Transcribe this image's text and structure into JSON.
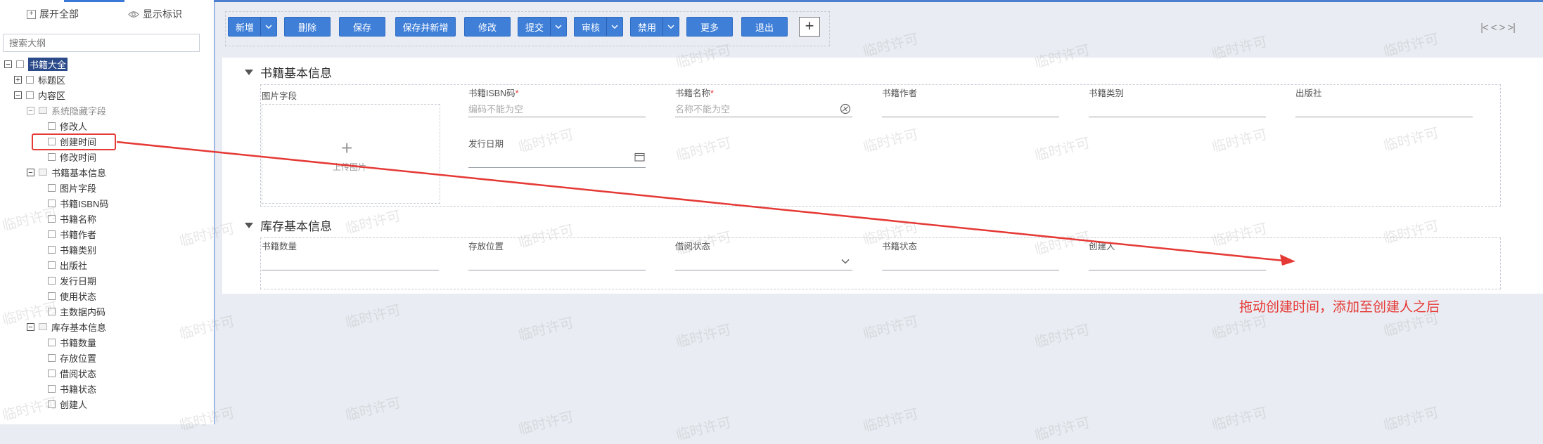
{
  "sidebar": {
    "expand_all": "展开全部",
    "show_marks": "显示标识",
    "search_placeholder": "搜索大纲",
    "tree": [
      {
        "label": "书籍大全",
        "toggle": "−",
        "level": 0,
        "selected": true
      },
      {
        "label": "标题区",
        "toggle": "+",
        "level": 1
      },
      {
        "label": "内容区",
        "toggle": "−",
        "level": 1
      },
      {
        "label": "系统隐藏字段",
        "toggle": "−",
        "level": 2,
        "dim": true
      },
      {
        "label": "修改人",
        "level": 3
      },
      {
        "label": "创建时间",
        "level": 3
      },
      {
        "label": "修改时间",
        "level": 3
      },
      {
        "label": "书籍基本信息",
        "toggle": "−",
        "level": 2
      },
      {
        "label": "图片字段",
        "level": 3
      },
      {
        "label": "书籍ISBN码",
        "level": 3
      },
      {
        "label": "书籍名称",
        "level": 3
      },
      {
        "label": "书籍作者",
        "level": 3
      },
      {
        "label": "书籍类别",
        "level": 3
      },
      {
        "label": "出版社",
        "level": 3
      },
      {
        "label": "发行日期",
        "level": 3
      },
      {
        "label": "使用状态",
        "level": 3
      },
      {
        "label": "主数据内码",
        "level": 3
      },
      {
        "label": "库存基本信息",
        "toggle": "−",
        "level": 2
      },
      {
        "label": "书籍数量",
        "level": 3
      },
      {
        "label": "存放位置",
        "level": 3
      },
      {
        "label": "借阅状态",
        "level": 3
      },
      {
        "label": "书籍状态",
        "level": 3
      },
      {
        "label": "创建人",
        "level": 3
      }
    ]
  },
  "toolbar": {
    "buttons": [
      {
        "label": "新增",
        "dropdown": true
      },
      {
        "label": "删除"
      },
      {
        "label": "保存"
      },
      {
        "label": "保存并新增"
      },
      {
        "label": "修改"
      },
      {
        "label": "提交",
        "dropdown": true
      },
      {
        "label": "审核",
        "dropdown": true
      },
      {
        "label": "禁用",
        "dropdown": true
      },
      {
        "label": "更多"
      },
      {
        "label": "退出"
      }
    ],
    "add_symbol": "+",
    "nav_symbols": [
      "|<",
      "<",
      ">",
      ">|"
    ]
  },
  "sections": {
    "basic": {
      "title": "书籍基本信息",
      "image_label": "图片字段",
      "upload_text": "上传图片",
      "fields": {
        "isbn": {
          "label": "书籍ISBN码",
          "required": "*",
          "placeholder": "编码不能为空"
        },
        "name": {
          "label": "书籍名称",
          "required": "*",
          "placeholder": "名称不能为空"
        },
        "author": {
          "label": "书籍作者"
        },
        "category": {
          "label": "书籍类别"
        },
        "publisher": {
          "label": "出版社"
        },
        "release_date": {
          "label": "发行日期"
        }
      }
    },
    "stock": {
      "title": "库存基本信息",
      "fields": {
        "quantity": {
          "label": "书籍数量"
        },
        "location": {
          "label": "存放位置"
        },
        "borrow_status": {
          "label": "借阅状态"
        },
        "book_status": {
          "label": "书籍状态"
        },
        "creator": {
          "label": "创建人"
        }
      }
    }
  },
  "annotation": {
    "instruction": "拖动创建时间，添加至创建人之后",
    "color": "#e53935"
  },
  "watermark": "临时许可",
  "colors": {
    "primary": "#3f7fd8",
    "accent_red": "#e53935",
    "background": "#e9ecf2"
  }
}
